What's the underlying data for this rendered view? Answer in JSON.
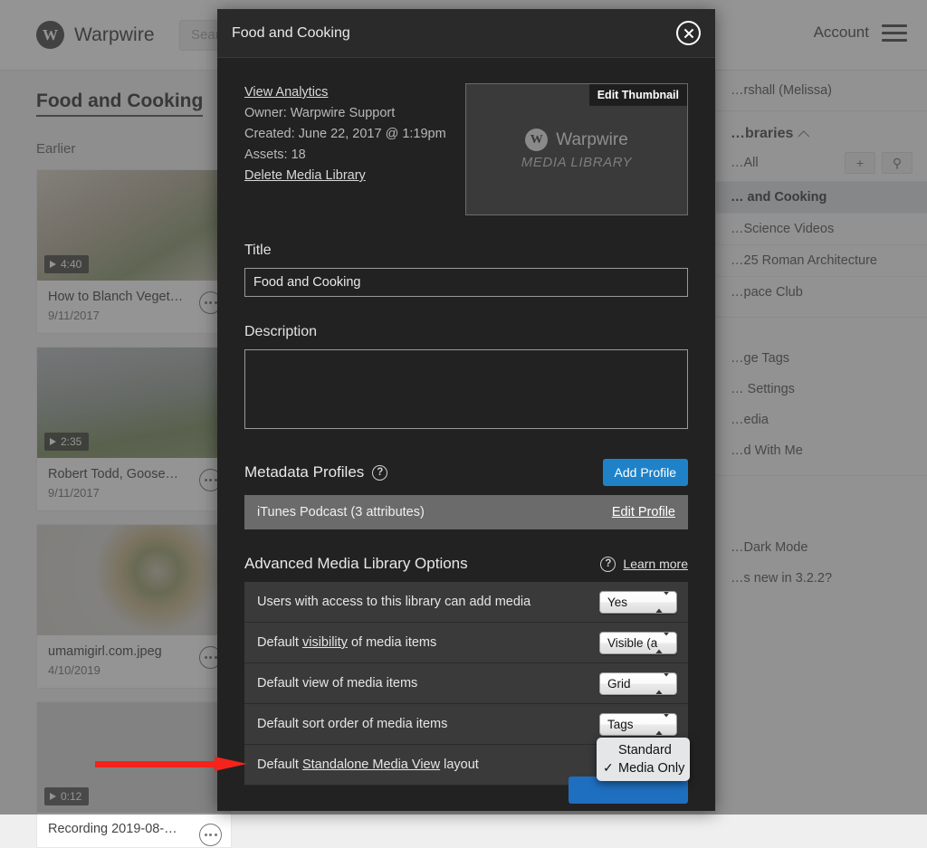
{
  "background": {
    "brand": {
      "logo_letter": "W",
      "name": "Warpwire"
    },
    "search": {
      "placeholder": "Search"
    },
    "account": {
      "label": "Account",
      "menu_icon": "hamburger-icon"
    },
    "main": {
      "page_title": "Food and Cooking",
      "group_label": "Earlier",
      "cards": [
        {
          "title": "How to Blanch Veget…",
          "date": "9/11/2017",
          "duration": "4:40",
          "has_duration": true
        },
        {
          "title": "Robert Todd, Goose…",
          "date": "9/11/2017",
          "duration": "2:35",
          "has_duration": true
        },
        {
          "title": "umamigirl.com.jpeg",
          "date": "4/10/2019",
          "duration": "",
          "has_duration": false
        },
        {
          "title": "Recording 2019-08-…",
          "date": "",
          "duration": "0:12",
          "has_duration": true
        }
      ]
    },
    "sidebar": {
      "user": "…rshall (Melissa)",
      "section_title": "…braries",
      "all_label": "…All",
      "add_icon": "plus-icon",
      "search_icon": "search-icon",
      "libraries": [
        "… and Cooking",
        "…Science Videos",
        "…25 Roman Architecture",
        "…pace Club"
      ],
      "active_library": "… and Cooking",
      "links": [
        "…ge Tags",
        "… Settings",
        "…edia",
        "…d With Me"
      ],
      "footer_links": [
        "…Dark Mode",
        "…s new in 3.2.2?"
      ]
    }
  },
  "modal": {
    "header": {
      "title": "Food and Cooking",
      "close_icon": "close-icon"
    },
    "info": {
      "analytics_link": "View Analytics",
      "owner": "Owner: Warpwire Support",
      "created": "Created: June 22, 2017 @ 1:19pm",
      "assets": "Assets: 18",
      "delete_link": "Delete Media Library"
    },
    "thumbnail": {
      "edit_label": "Edit Thumbnail",
      "logo_letter": "W",
      "logo_name": "Warpwire",
      "subtitle": "MEDIA LIBRARY"
    },
    "title_field": {
      "label": "Title",
      "value": "Food and Cooking",
      "placeholder": ""
    },
    "description_field": {
      "label": "Description",
      "value": "",
      "placeholder": ""
    },
    "metadata": {
      "heading": "Metadata Profiles",
      "help_icon": "question-mark-icon",
      "add_button": "Add Profile",
      "profile_name": "iTunes Podcast (3 attributes)",
      "edit_link": "Edit Profile"
    },
    "advanced": {
      "heading": "Advanced Media Library Options",
      "help_icon": "question-mark-icon",
      "learn_more": "Learn more",
      "options": [
        {
          "label": "Users with access to this library can add media",
          "label_plain": "Users with access to this library can add media",
          "underlined": "",
          "value": "Yes"
        },
        {
          "label": "Default visibility of media items",
          "label_plain_pre": "Default ",
          "underlined": "visibility",
          "label_plain_post": " of media items",
          "value": "Visible (a"
        },
        {
          "label": "Default view of media items",
          "label_plain": "Default view of media items",
          "underlined": "",
          "value": "Grid"
        },
        {
          "label": "Default sort order of media items",
          "label_plain": "Default sort order of media items",
          "underlined": "",
          "value": "Tags"
        },
        {
          "label": "Default Standalone Media View layout",
          "label_plain_pre": "Default ",
          "underlined": "Standalone Media View",
          "label_plain_post": " layout",
          "value": "Media Only"
        }
      ]
    },
    "open_dropdown": {
      "options": [
        {
          "label": "Standard",
          "checked": false
        },
        {
          "label": "Media Only",
          "checked": true
        }
      ],
      "check_glyph": "✓"
    }
  },
  "annotation": {
    "arrow_color": "#f4231c",
    "type": "arrow-right"
  },
  "colors": {
    "accent_blue": "#1f82c8",
    "modal_bg": "#222222",
    "row_bg": "#3a3a3a",
    "profile_bg": "#6b6b6b"
  }
}
